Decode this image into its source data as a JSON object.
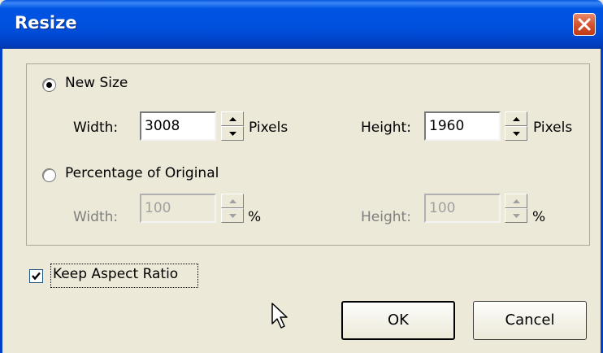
{
  "window": {
    "title": "Resize"
  },
  "new_size": {
    "option_label": "New Size",
    "width_label": "Width:",
    "width_value": "3008",
    "width_unit": "Pixels",
    "height_label": "Height:",
    "height_value": "1960",
    "height_unit": "Pixels",
    "selected": true
  },
  "percentage": {
    "option_label": "Percentage of Original",
    "width_label": "Width:",
    "width_value": "100",
    "width_unit": "%",
    "height_label": "Height:",
    "height_value": "100",
    "height_unit": "%",
    "selected": false
  },
  "keep_aspect": {
    "label": "Keep Aspect Ratio",
    "checked": true
  },
  "buttons": {
    "ok": "OK",
    "cancel": "Cancel"
  },
  "icons": {
    "close": "close-icon",
    "cursor": "mouse-pointer-icon"
  }
}
